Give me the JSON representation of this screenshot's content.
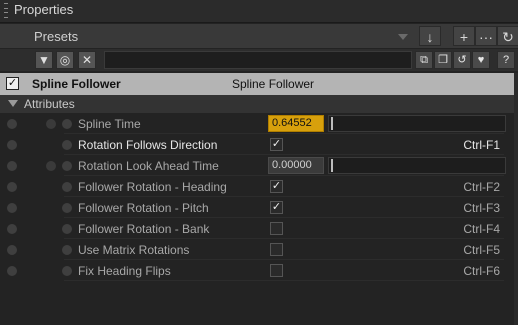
{
  "window": {
    "title": "Properties"
  },
  "presets": {
    "label": "Presets"
  },
  "toolbar_buttons": [
    {
      "name": "download-button",
      "icon": "download-arrow-icon",
      "glyph": "↓"
    },
    {
      "name": "add-button",
      "icon": "plus-icon",
      "glyph": "+"
    },
    {
      "name": "more-button",
      "icon": "ellipsis-icon",
      "glyph": "···"
    },
    {
      "name": "refresh-button",
      "icon": "refresh-icon",
      "glyph": "↻"
    }
  ],
  "filter_buttons": [
    {
      "name": "filter-button",
      "icon": "funnel-icon",
      "glyph": "▼"
    },
    {
      "name": "target-button",
      "icon": "target-icon",
      "glyph": "◎"
    },
    {
      "name": "clear-button",
      "icon": "close-icon",
      "glyph": "✕"
    }
  ],
  "right_buttons": [
    {
      "name": "copy-button",
      "icon": "copy-icon",
      "glyph": "⧉"
    },
    {
      "name": "paste-button",
      "icon": "paste-icon",
      "glyph": "❐"
    },
    {
      "name": "reset-button",
      "icon": "undo-icon",
      "glyph": "↺"
    },
    {
      "name": "favorite-button",
      "icon": "heart-icon",
      "glyph": "♥"
    },
    {
      "name": "help-button",
      "icon": "question-icon",
      "glyph": "?"
    }
  ],
  "object": {
    "name": "Spline Follower",
    "type": "Spline Follower",
    "enabled_glyph": "✓"
  },
  "group": {
    "label": "Attributes"
  },
  "attributes": [
    {
      "label": "Spline Time",
      "kind": "number",
      "value": "0.64552",
      "style": "orange",
      "slider": true,
      "shortcut": "",
      "highlight": false,
      "keyframe": true
    },
    {
      "label": "Rotation Follows Direction",
      "kind": "check",
      "checked": true,
      "shortcut": "Ctrl-F1",
      "highlight": true,
      "keyframe": false
    },
    {
      "label": "Rotation Look Ahead Time",
      "kind": "number",
      "value": "0.00000",
      "style": "gray",
      "slider": true,
      "shortcut": "",
      "highlight": false,
      "keyframe": true
    },
    {
      "label": "Follower Rotation - Heading",
      "kind": "check",
      "checked": true,
      "shortcut": "Ctrl-F2",
      "highlight": false,
      "keyframe": false
    },
    {
      "label": "Follower Rotation - Pitch",
      "kind": "check",
      "checked": true,
      "shortcut": "Ctrl-F3",
      "highlight": false,
      "keyframe": false
    },
    {
      "label": "Follower Rotation - Bank",
      "kind": "check",
      "checked": false,
      "shortcut": "Ctrl-F4",
      "highlight": false,
      "keyframe": false
    },
    {
      "label": "Use Matrix Rotations",
      "kind": "check",
      "checked": false,
      "shortcut": "Ctrl-F5",
      "highlight": false,
      "keyframe": false
    },
    {
      "label": "Fix Heading Flips",
      "kind": "check",
      "checked": false,
      "shortcut": "Ctrl-F6",
      "highlight": false,
      "keyframe": false
    }
  ],
  "colors": {
    "accent_value": "#d7a00c",
    "header_bg": "#b4b4b4",
    "panel_bg": "#232323"
  }
}
